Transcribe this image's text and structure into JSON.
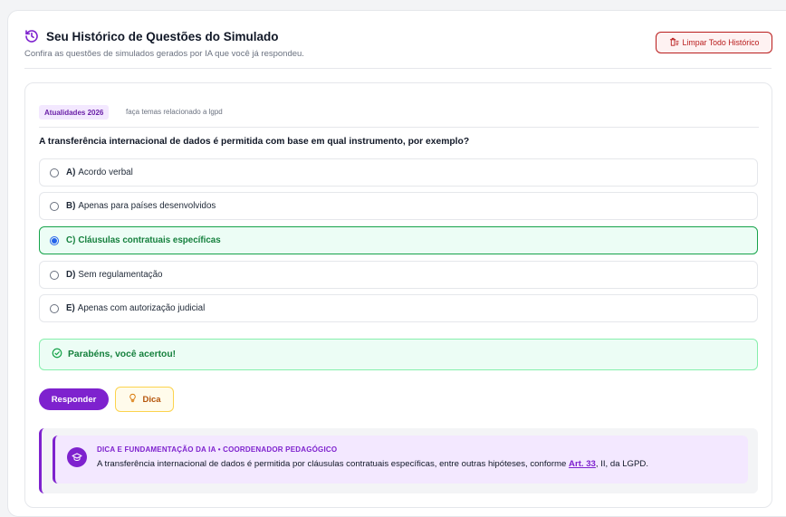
{
  "header": {
    "title": "Seu Histórico de Questões do Simulado",
    "subtitle": "Confira as questões de simulados gerados por IA que você já respondeu.",
    "clear_label": "Limpar Todo Histórico"
  },
  "question_card": {
    "tag": "Atualidades 2026",
    "topic_note": "faça temas relacionado a lgpd",
    "question": "A transferência internacional de dados é permitida com base em qual instrumento, por exemplo?",
    "options": [
      {
        "letter": "A)",
        "text": "Acordo verbal"
      },
      {
        "letter": "B)",
        "text": "Apenas para países desenvolvidos"
      },
      {
        "letter": "C)",
        "text": "Cláusulas contratuais específicas"
      },
      {
        "letter": "D)",
        "text": "Sem regulamentação"
      },
      {
        "letter": "E)",
        "text": "Apenas com autorização judicial"
      }
    ],
    "selected_option": "C)",
    "feedback": "Parabéns, você acertou!",
    "answer_label": "Responder",
    "hint_label": "Dica",
    "hint": {
      "title": "DICA E FUNDAMENTAÇÃO DA IA • COORDENADOR PEDAGÓGICO",
      "text_before": "A transferência internacional de dados é permitida por cláusulas contratuais específicas, entre outras hipóteses, conforme ",
      "link": "Art. 33",
      "text_after": ", II, da LGPD."
    }
  },
  "colors": {
    "accent": "#7e22ce",
    "success": "#15803d",
    "danger": "#b91c1c",
    "warning": "#b45309"
  },
  "icons": [
    "history-icon",
    "trash-icon",
    "check-circle-icon",
    "lightbulb-icon",
    "mortarboard-icon"
  ]
}
